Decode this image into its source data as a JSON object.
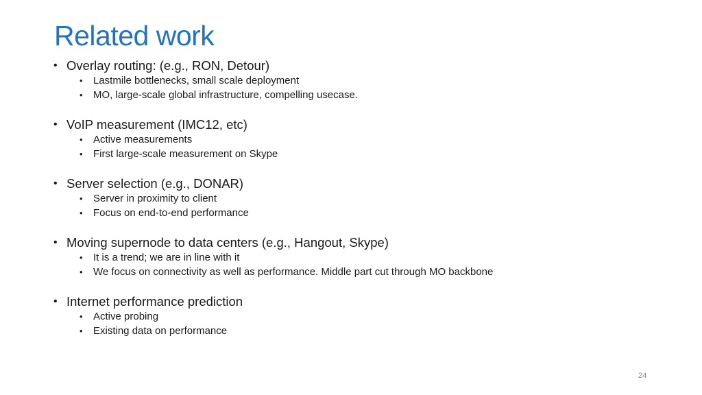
{
  "slide": {
    "title": "Related work",
    "page_number": "24",
    "title_color": "#1f73c2",
    "bullet_glyph": "•",
    "sections": [
      {
        "heading": "Overlay routing: (e.g., RON, Detour)",
        "items": [
          "Lastmile bottlenecks, small scale deployment",
          "MO, large-scale global infrastructure, compelling usecase."
        ]
      },
      {
        "heading": "VoIP measurement (IMC12, etc)",
        "items": [
          "Active measurements",
          "First large-scale measurement on Skype"
        ]
      },
      {
        "heading": "Server selection (e.g., DONAR)",
        "items": [
          "Server in proximity to client",
          "Focus on end-to-end performance"
        ]
      },
      {
        "heading": "Moving supernode to data centers (e.g., Hangout, Skype)",
        "items": [
          "It is a trend; we are in line with it",
          "We focus on connectivity as well as performance. Middle part cut through MO backbone"
        ]
      },
      {
        "heading": "Internet performance prediction",
        "items": [
          "Active probing",
          "Existing data on performance"
        ]
      }
    ]
  }
}
